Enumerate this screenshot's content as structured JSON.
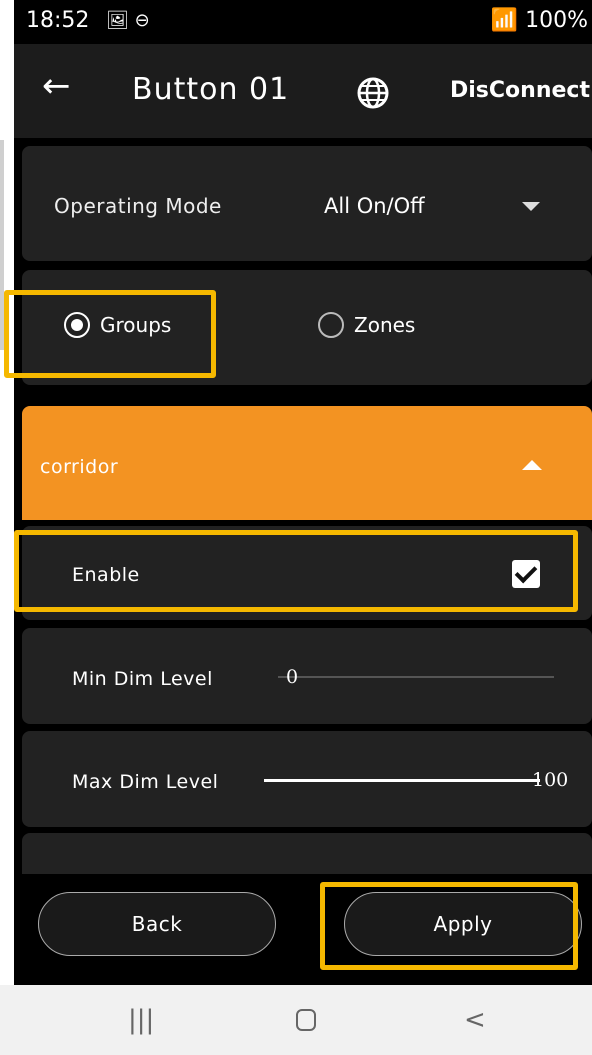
{
  "status_bar": {
    "time": "18:52",
    "icons_left": "🖼 ⊖",
    "signal_battery": "📶 100%"
  },
  "app_bar": {
    "back_icon": "arrow-left",
    "title": "Button 01",
    "globe_icon": "globe",
    "disconnect_label": "DisConnect"
  },
  "operating_mode": {
    "label": "Operating Mode",
    "value": "All On/Off"
  },
  "target_type": {
    "groups_label": "Groups",
    "zones_label": "Zones",
    "selected": "Groups"
  },
  "group": {
    "name": "corridor",
    "expanded": true
  },
  "enable": {
    "label": "Enable",
    "checked": true
  },
  "min_dim": {
    "label": "Min Dim Level",
    "value": "0",
    "level": 0
  },
  "max_dim": {
    "label": "Max Dim Level",
    "value": "100",
    "level": 100
  },
  "footer": {
    "back_label": "Back",
    "apply_label": "Apply"
  },
  "system_nav": {
    "recents": "|||",
    "back": "<"
  },
  "colors": {
    "accent_orange": "#f39322",
    "highlight_yellow": "#f5b800",
    "card_bg": "#222222",
    "appbar_bg": "#1c1c1c"
  }
}
